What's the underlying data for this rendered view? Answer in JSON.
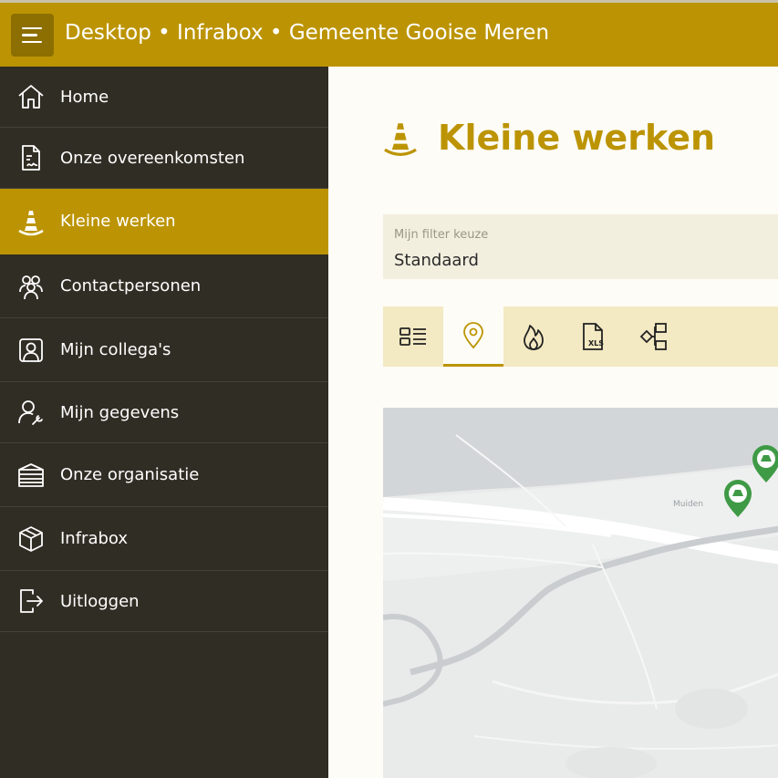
{
  "header": {
    "title": "Desktop • Infrabox • Gemeente Gooise Meren",
    "menu_icon": "menu-icon"
  },
  "sidebar": {
    "items": [
      {
        "label": "Home",
        "icon": "home-icon"
      },
      {
        "label": "Onze overeenkomsten",
        "icon": "contract-icon"
      },
      {
        "label": "Kleine werken",
        "icon": "traffic-cone-icon",
        "active": true
      },
      {
        "label": "Contactpersonen",
        "icon": "people-icon"
      },
      {
        "label": "Mijn collega's",
        "icon": "colleague-icon"
      },
      {
        "label": "Mijn gegevens",
        "icon": "user-settings-icon"
      },
      {
        "label": "Onze organisatie",
        "icon": "building-icon"
      },
      {
        "label": "Infrabox",
        "icon": "box-icon"
      },
      {
        "label": "Uitloggen",
        "icon": "logout-icon"
      }
    ]
  },
  "main": {
    "title": "Kleine werken",
    "filter": {
      "label": "Mijn filter keuze",
      "value": "Standaard"
    },
    "view_tabs": [
      {
        "icon": "list-view-icon"
      },
      {
        "icon": "map-pin-icon",
        "active": true
      },
      {
        "icon": "flame-icon"
      },
      {
        "icon": "xls-export-icon"
      },
      {
        "icon": "diagram-icon"
      }
    ],
    "map": {
      "labels": [
        "Muiden"
      ]
    }
  },
  "colors": {
    "accent": "#bc9403",
    "sidebar": "#302d24",
    "marker": "#3f9a46"
  }
}
